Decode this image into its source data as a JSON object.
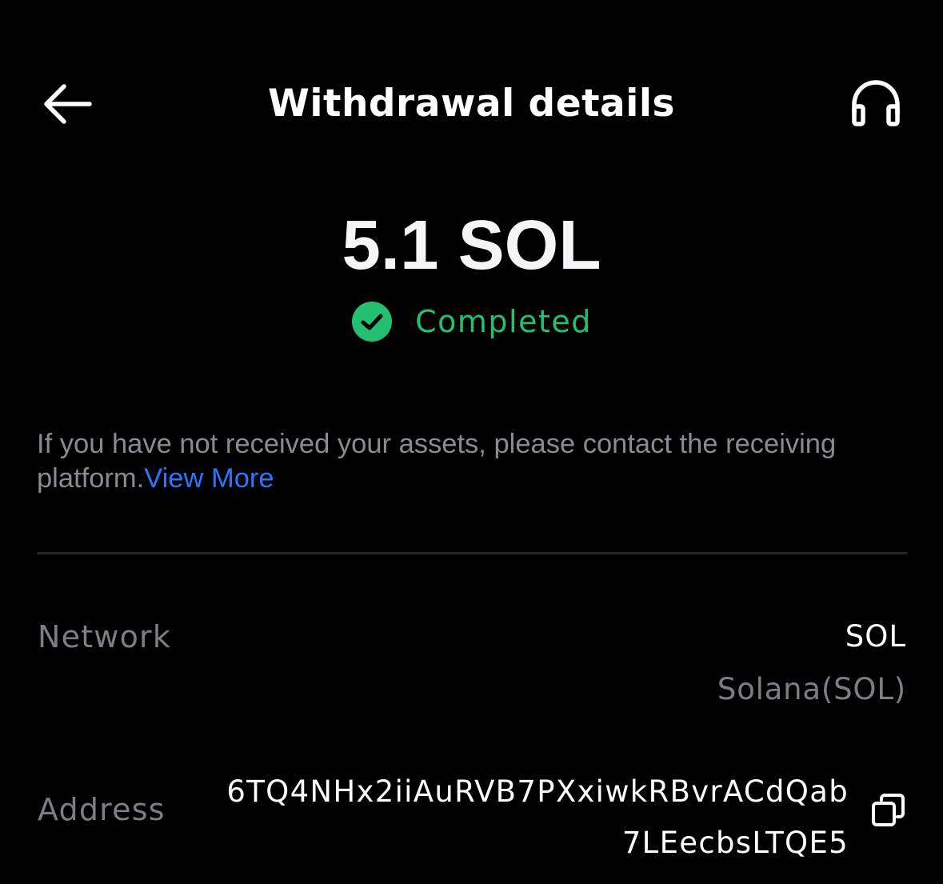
{
  "header": {
    "title": "Withdrawal details",
    "back_icon": "arrow-left-icon",
    "support_icon": "headset-icon"
  },
  "summary": {
    "amount": "5.1 SOL",
    "status": "Completed",
    "status_icon": "check-circle-icon",
    "status_color": "#22c070"
  },
  "notice": {
    "text": "If you have not received your assets, please contact the receiving platform.",
    "link_label": "View More",
    "link_color": "#2f74ff"
  },
  "details": {
    "network": {
      "label": "Network",
      "value": "SOL",
      "sub_value": "Solana(SOL)"
    },
    "address": {
      "label": "Address",
      "lines": [
        "6TQ4NHx2iiAuRVB7PXxiwkRBvrACdQab",
        "7LEecbsLTQE5"
      ],
      "copy_icon": "copy-icon"
    }
  }
}
